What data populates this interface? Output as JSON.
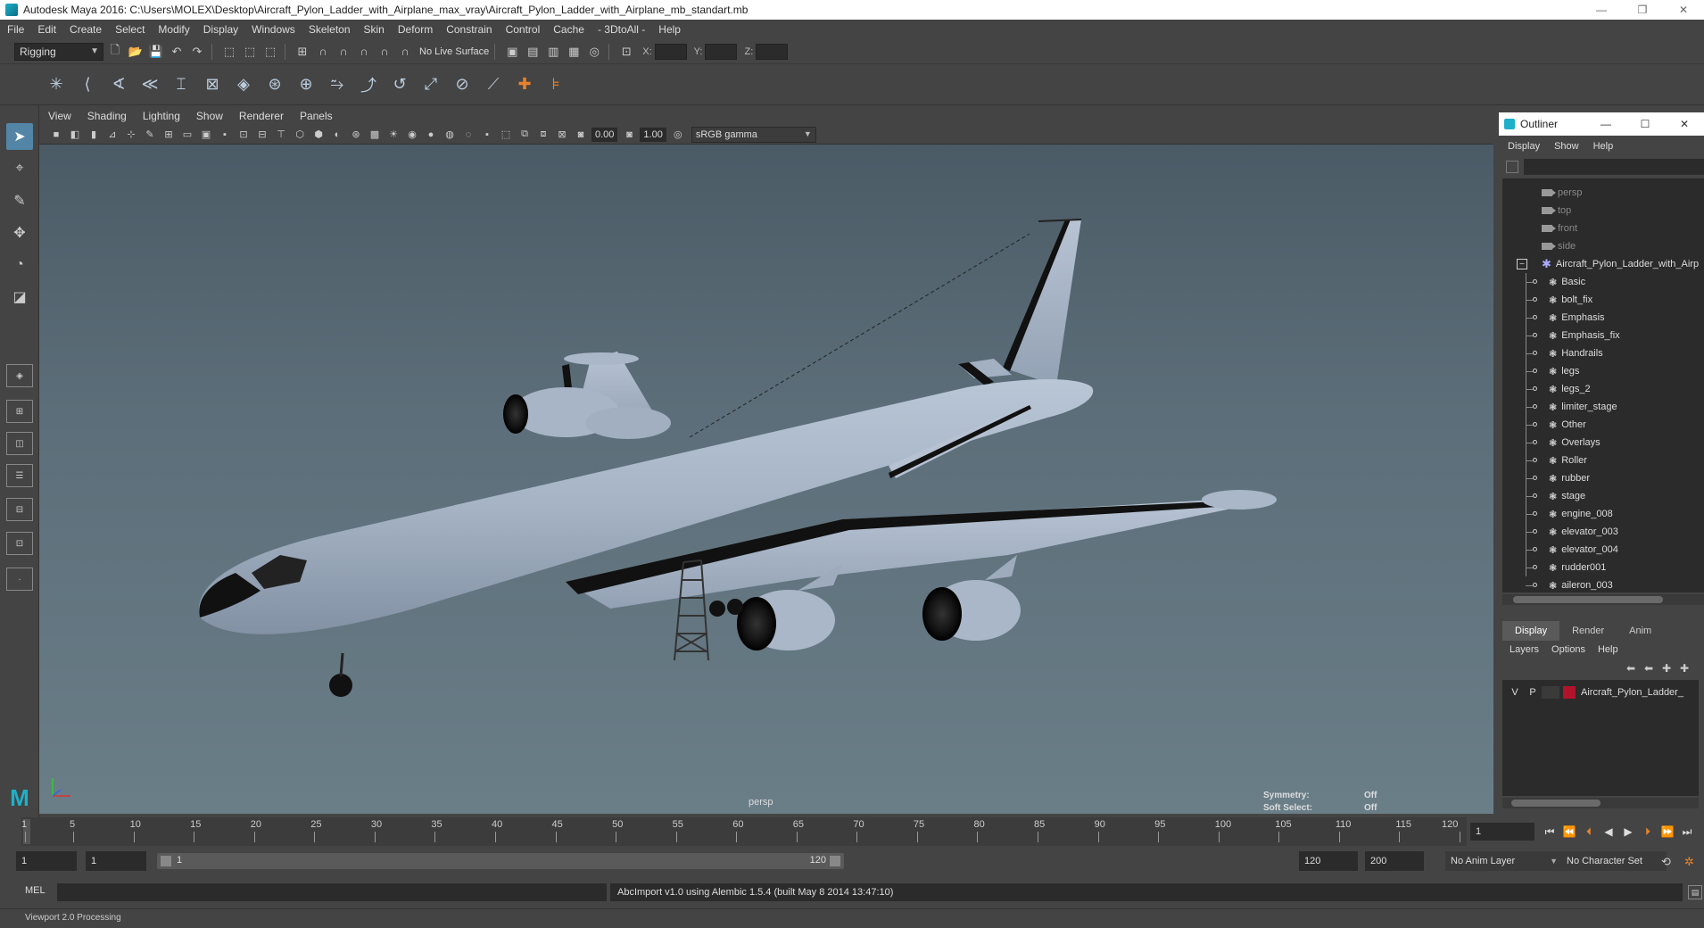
{
  "window": {
    "title": "Autodesk Maya 2016: C:\\Users\\MOLEX\\Desktop\\Aircraft_Pylon_Ladder_with_Airplane_max_vray\\Aircraft_Pylon_Ladder_with_Airplane_mb_standart.mb",
    "minimize": "—",
    "restore": "❐",
    "close": "✕"
  },
  "menu": [
    "File",
    "Edit",
    "Create",
    "Select",
    "Modify",
    "Display",
    "Windows",
    "Skeleton",
    "Skin",
    "Deform",
    "Constrain",
    "Control",
    "Cache",
    "- 3DtoAll -",
    "Help"
  ],
  "statusline": {
    "mode": "Rigging",
    "live_surface": "No Live Surface",
    "x_label": "X:",
    "y_label": "Y:",
    "z_label": "Z:"
  },
  "panel": {
    "menu": [
      "View",
      "Shading",
      "Lighting",
      "Show",
      "Renderer",
      "Panels"
    ],
    "exposure": "0.00",
    "gamma": "1.00",
    "color_space": "sRGB gamma",
    "camera": "persp",
    "hud": {
      "symmetry_label": "Symmetry:",
      "symmetry_value": "Off",
      "soft_select_label": "Soft Select:",
      "soft_select_value": "Off"
    }
  },
  "outliner": {
    "title": "Outliner",
    "menu": [
      "Display",
      "Show",
      "Help"
    ],
    "cameras": [
      "persp",
      "top",
      "front",
      "side"
    ],
    "root": "Aircraft_Pylon_Ladder_with_Airp",
    "children": [
      "Basic",
      "bolt_fix",
      "Emphasis",
      "Emphasis_fix",
      "Handrails",
      "legs",
      "legs_2",
      "limiter_stage",
      "Other",
      "Overlays",
      "Roller",
      "rubber",
      "stage",
      "engine_008",
      "elevator_003",
      "elevator_004",
      "rudder001",
      "aileron_003"
    ]
  },
  "layer_editor": {
    "tabs": [
      "Display",
      "Render",
      "Anim"
    ],
    "menu": [
      "Layers",
      "Options",
      "Help"
    ],
    "layer": {
      "v": "V",
      "p": "P",
      "name": "Aircraft_Pylon_Ladder_",
      "color": "#b1132a"
    }
  },
  "timeline": {
    "ticks": [
      "1",
      "5",
      "10",
      "15",
      "20",
      "25",
      "30",
      "35",
      "40",
      "45",
      "50",
      "55",
      "60",
      "65",
      "70",
      "75",
      "80",
      "85",
      "90",
      "95",
      "100",
      "105",
      "110",
      "115",
      "120"
    ],
    "current_frame": "1"
  },
  "range": {
    "start": "1",
    "anim_start": "1",
    "slider_start": "1",
    "slider_end": "120",
    "anim_end": "120",
    "end": "200",
    "anim_layer": "No Anim Layer",
    "character_set": "No Character Set"
  },
  "command": {
    "language": "MEL",
    "result": "AbcImport v1.0 using Alembic 1.5.4 (built May  8 2014 13:47:10)"
  },
  "help_line": "Viewport 2.0 Processing"
}
